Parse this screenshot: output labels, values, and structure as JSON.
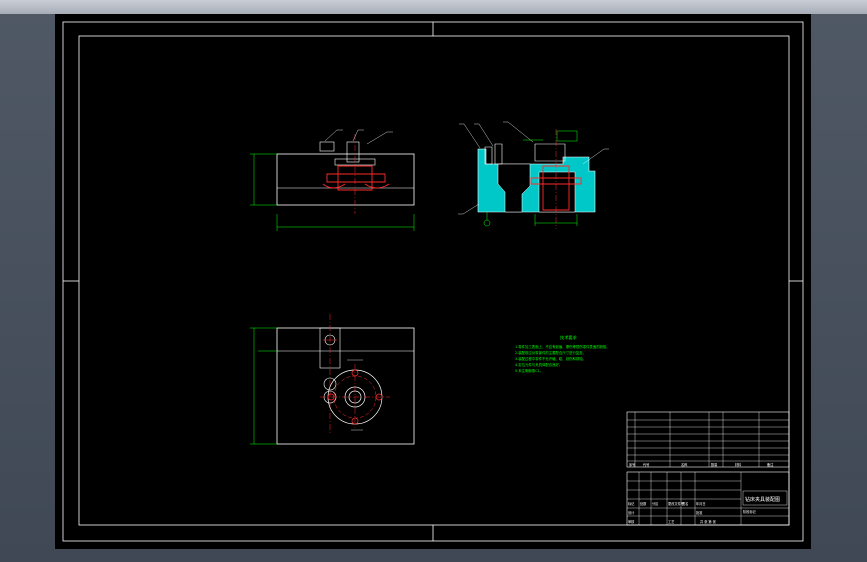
{
  "drawing": {
    "tech_notes_title": "技术要求",
    "tech_notes": [
      "1.零件加工表面上，不应有划痕、擦伤等损伤零件表面的缺陷。",
      "2.装配前应对零部件的主要配合尺寸进行复查。",
      "3.装配过程中零件不允许磕、碰、划伤和锈蚀。",
      "4.定位元件与夹具体配合良好。",
      "5.未注明倒角C1。"
    ],
    "colors": {
      "sheet": "#000000",
      "border": "#ffffff",
      "part": "#ffffff",
      "centerline": "#ff2a2a",
      "dimension": "#00ff00",
      "section_fill": "#00c8c8",
      "marker": "#ffff00"
    },
    "title_block": {
      "name": "钻床夹具装配图",
      "headers": [
        "序号",
        "代号",
        "名称",
        "数量",
        "材料",
        "备注"
      ],
      "sign_labels": [
        "标记",
        "处数",
        "分区",
        "更改文件号",
        "签名",
        "年月日"
      ],
      "role_labels": [
        "设计",
        "审核",
        "工艺",
        "批准"
      ],
      "stage_label": "阶段标记",
      "sheet_label": "共 张 第 张"
    }
  }
}
